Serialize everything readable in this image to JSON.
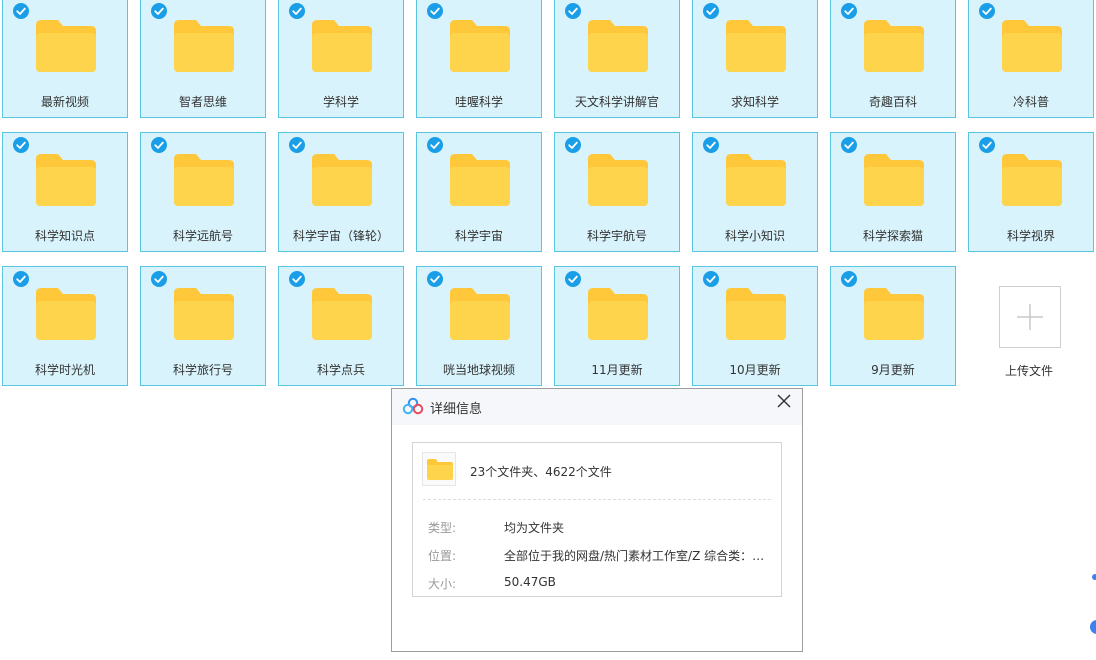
{
  "folders": [
    {
      "label": "最新视频"
    },
    {
      "label": "智者思维"
    },
    {
      "label": "学科学"
    },
    {
      "label": "哇喔科学"
    },
    {
      "label": "天文科学讲解官"
    },
    {
      "label": "求知科学"
    },
    {
      "label": "奇趣百科"
    },
    {
      "label": "冷科普"
    },
    {
      "label": "科学知识点"
    },
    {
      "label": "科学远航号"
    },
    {
      "label": "科学宇宙（锋轮）"
    },
    {
      "label": "科学宇宙"
    },
    {
      "label": "科学宇航号"
    },
    {
      "label": "科学小知识"
    },
    {
      "label": "科学探索猫"
    },
    {
      "label": "科学视界"
    },
    {
      "label": "科学时光机"
    },
    {
      "label": "科学旅行号"
    },
    {
      "label": "科学点兵"
    },
    {
      "label": "咣当地球视频"
    },
    {
      "label": "11月更新"
    },
    {
      "label": "10月更新"
    },
    {
      "label": "9月更新"
    }
  ],
  "upload": {
    "label": "上传文件"
  },
  "dialog": {
    "title": "详细信息",
    "summary": "23个文件夹、4622个文件",
    "rows": [
      {
        "key": "类型:",
        "value": "均为文件夹"
      },
      {
        "key": "位置:",
        "value": "全部位于我的网盘/热门素材工作室/Z 综合类：古…"
      },
      {
        "key": "大小:",
        "value": "50.47GB"
      }
    ]
  },
  "colors": {
    "tile_bg": "#d8f3fb",
    "tile_border": "#5ac7e2",
    "folder": "#ffd44d",
    "folder_back": "#ffc83a",
    "check": "#1a9ee8"
  }
}
